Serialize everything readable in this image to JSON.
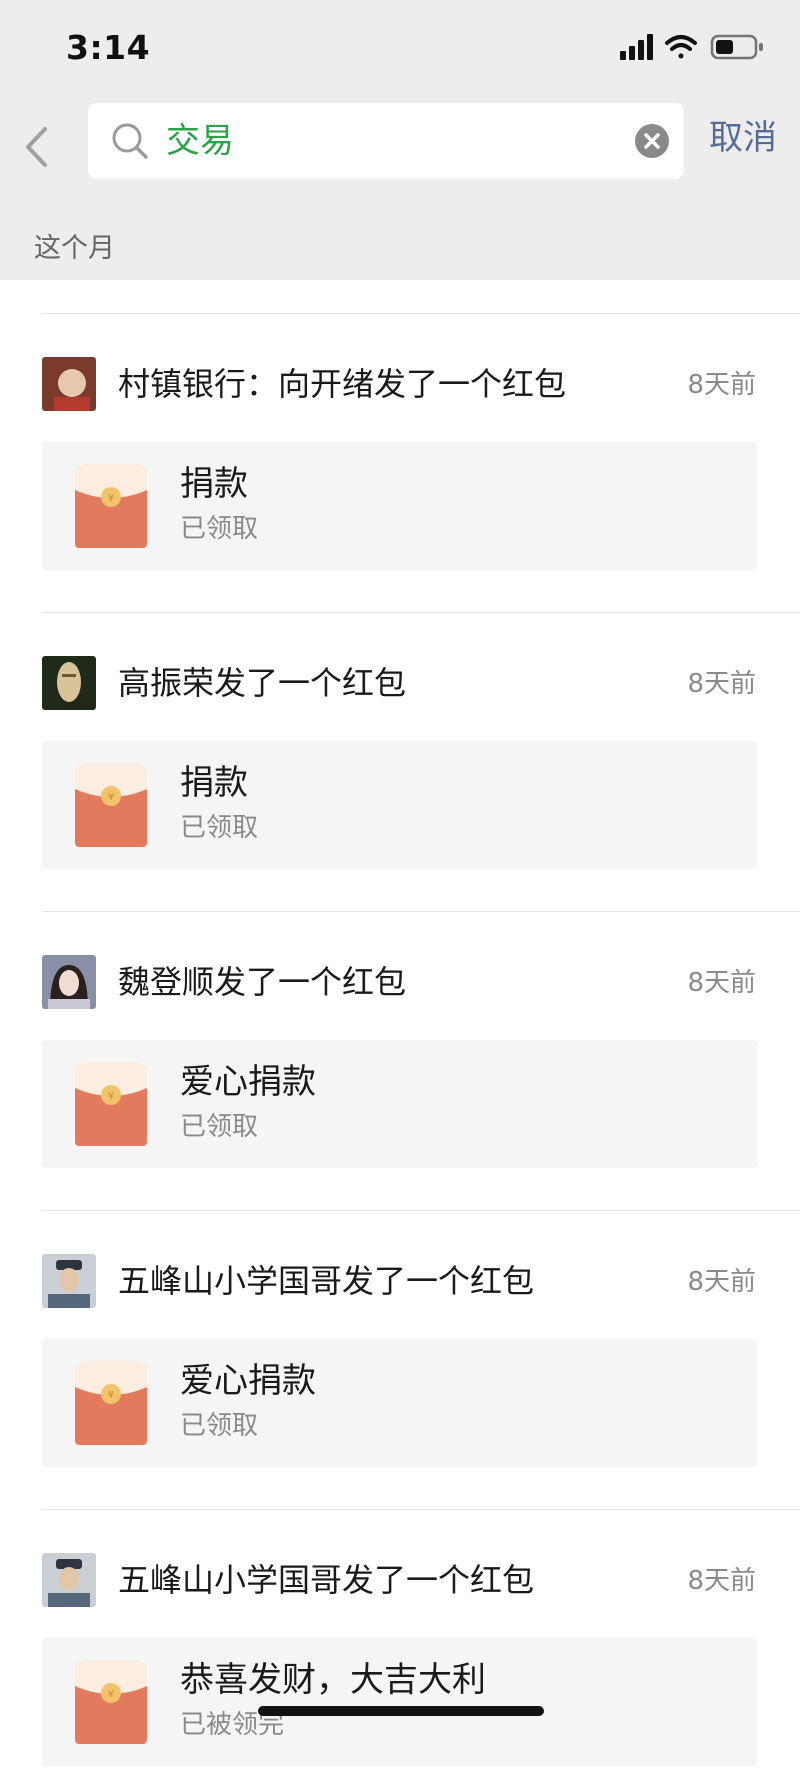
{
  "status_bar": {
    "time": "3:14"
  },
  "search": {
    "query": "交易",
    "cancel_label": "取消"
  },
  "section_label": "这个月",
  "items": [
    {
      "sender": "村镇银行：向开绪发了一个红包",
      "time": "8天前",
      "title": "捐款",
      "status": "已领取",
      "avatar_colors": [
        "#7a3b2e",
        "#e8c9b0"
      ]
    },
    {
      "sender": "高振荣发了一个红包",
      "time": "8天前",
      "title": "捐款",
      "status": "已领取",
      "avatar_colors": [
        "#1f2a1a",
        "#d9c49a"
      ]
    },
    {
      "sender": "魏登顺发了一个红包",
      "time": "8天前",
      "title": "爱心捐款",
      "status": "已领取",
      "avatar_colors": [
        "#8a8fa8",
        "#f0dcd3"
      ]
    },
    {
      "sender": "五峰山小学国哥发了一个红包",
      "time": "8天前",
      "title": "爱心捐款",
      "status": "已领取",
      "avatar_colors": [
        "#55677a",
        "#e2c7a8"
      ]
    },
    {
      "sender": "五峰山小学国哥发了一个红包",
      "time": "8天前",
      "title": "恭喜发财，大吉大利",
      "status": "已被领完",
      "avatar_colors": [
        "#55677a",
        "#e2c7a8"
      ]
    }
  ],
  "colors": {
    "accent_green": "#2ba246",
    "link_blue": "#576b95",
    "envelope_red": "#e37a5e",
    "envelope_flap": "#fbeee0",
    "envelope_seal": "#f2c36b"
  },
  "icons": [
    "chevron-left-icon",
    "search-icon",
    "clear-icon",
    "cellular-signal-icon",
    "wifi-icon",
    "battery-icon",
    "red-envelope-icon"
  ]
}
